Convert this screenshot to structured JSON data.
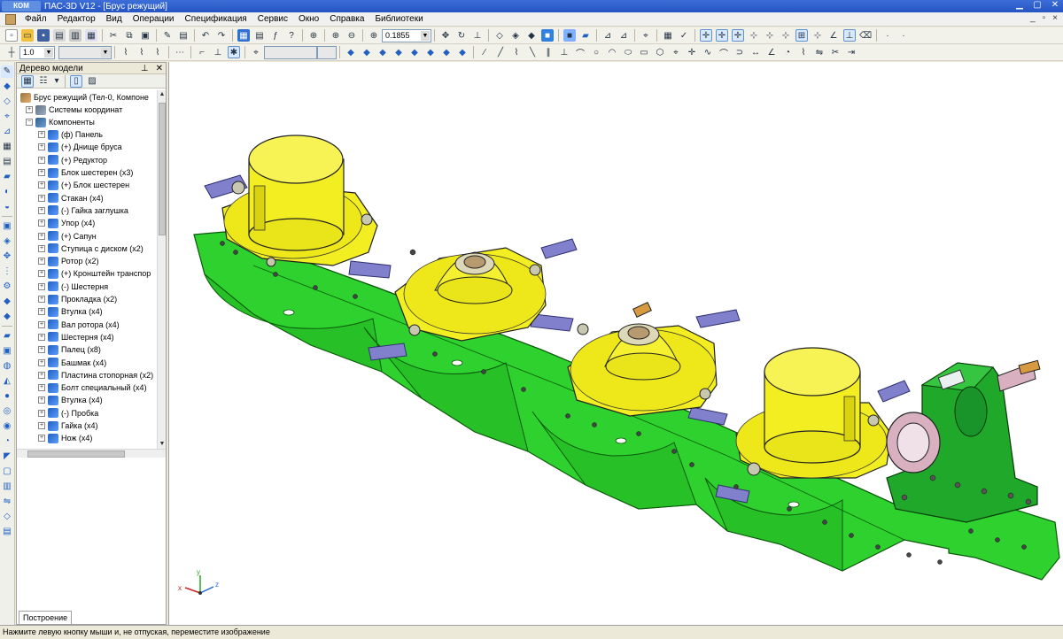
{
  "app": {
    "logo_text": "КОМ",
    "title": "ПАС-3D V12 - [Брус режущий]"
  },
  "menu": [
    "Файл",
    "Редактор",
    "Вид",
    "Операции",
    "Спецификация",
    "Сервис",
    "Окно",
    "Справка",
    "Библиотеки"
  ],
  "toolbar": {
    "zoom_value": "0.1855",
    "line_scale": "1.0"
  },
  "tree": {
    "panel_title": "Дерево модели",
    "root": "Брус режущий (Тел-0, Компоне",
    "coord_systems": "Системы координат",
    "components_label": "Компоненты",
    "items": [
      "(ф) Панель",
      "(+) Днище бруса",
      "(+) Редуктор",
      "Блок шестерен (x3)",
      "(+) Блок шестерен",
      "Стакан (x4)",
      "(-) Гайка заглушка",
      "Упор (x4)",
      "(+) Сапун",
      "Ступица с диском (x2)",
      "Ротор (x2)",
      "(+) Кронштейн транспор",
      "(-) Шестерня",
      "Прокладка (x2)",
      "Втулка (x4)",
      "Вал ротора (x4)",
      "Шестерня (x4)",
      "Палец (x8)",
      "Башмак (x4)",
      "Пластина стопорная (x2)",
      "Болт специальный (x4)",
      "Втулка (x4)",
      "(-) Пробка",
      "Гайка (x4)",
      "Нож (x4)"
    ],
    "tab_label": "Построение"
  },
  "axes": {
    "x": "x",
    "y": "y",
    "z": "z"
  },
  "status": "Нажмите левую кнопку мыши и, не отпуская, переместите изображение",
  "colors": {
    "frame_green": "#2ed12e",
    "part_yellow": "#f2ee22",
    "knife_blue": "#8080cc",
    "gearbox_green": "#1fa82a"
  }
}
